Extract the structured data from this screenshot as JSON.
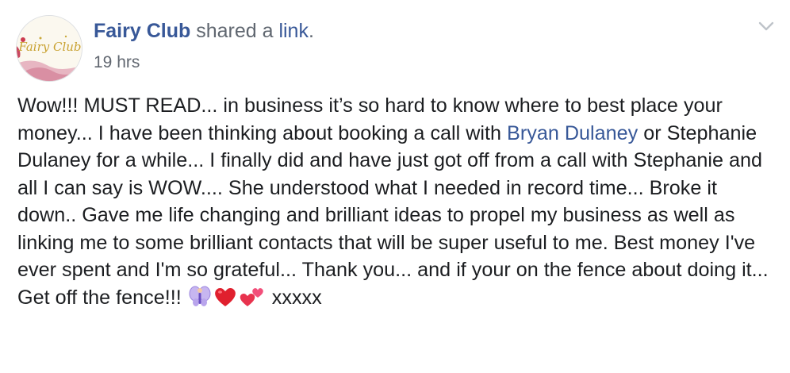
{
  "post": {
    "page_name": "Fairy Club",
    "shared_text": "shared a",
    "link_text": "link",
    "period": ".",
    "timestamp": "19 hrs",
    "avatar_logo_text": "Fairy Club",
    "body": {
      "seg1": "Wow!!! MUST READ... in business it’s so hard to know where to best place your money... I have been thinking about booking a call with ",
      "mention": "Bryan Dulaney",
      "seg2": " or Stephanie Dulaney for a while... I finally did and have just got off from a call with Stephanie and all I can say is WOW.... She understood what I needed in record time... Broke it down.. Gave me life changing and brilliant ideas to propel my business as well as linking me to some brilliant contacts that will be super useful to me. Best money I've ever spent and I'm so grateful... Thank you... and if your on the fence about doing it... Get off the fence!!! ",
      "emojis": [
        "fairy-emoji",
        "red-heart-emoji",
        "two-hearts-emoji"
      ],
      "signoff": "xxxxx"
    },
    "icons": {
      "menu": "chevron-down-icon"
    }
  }
}
